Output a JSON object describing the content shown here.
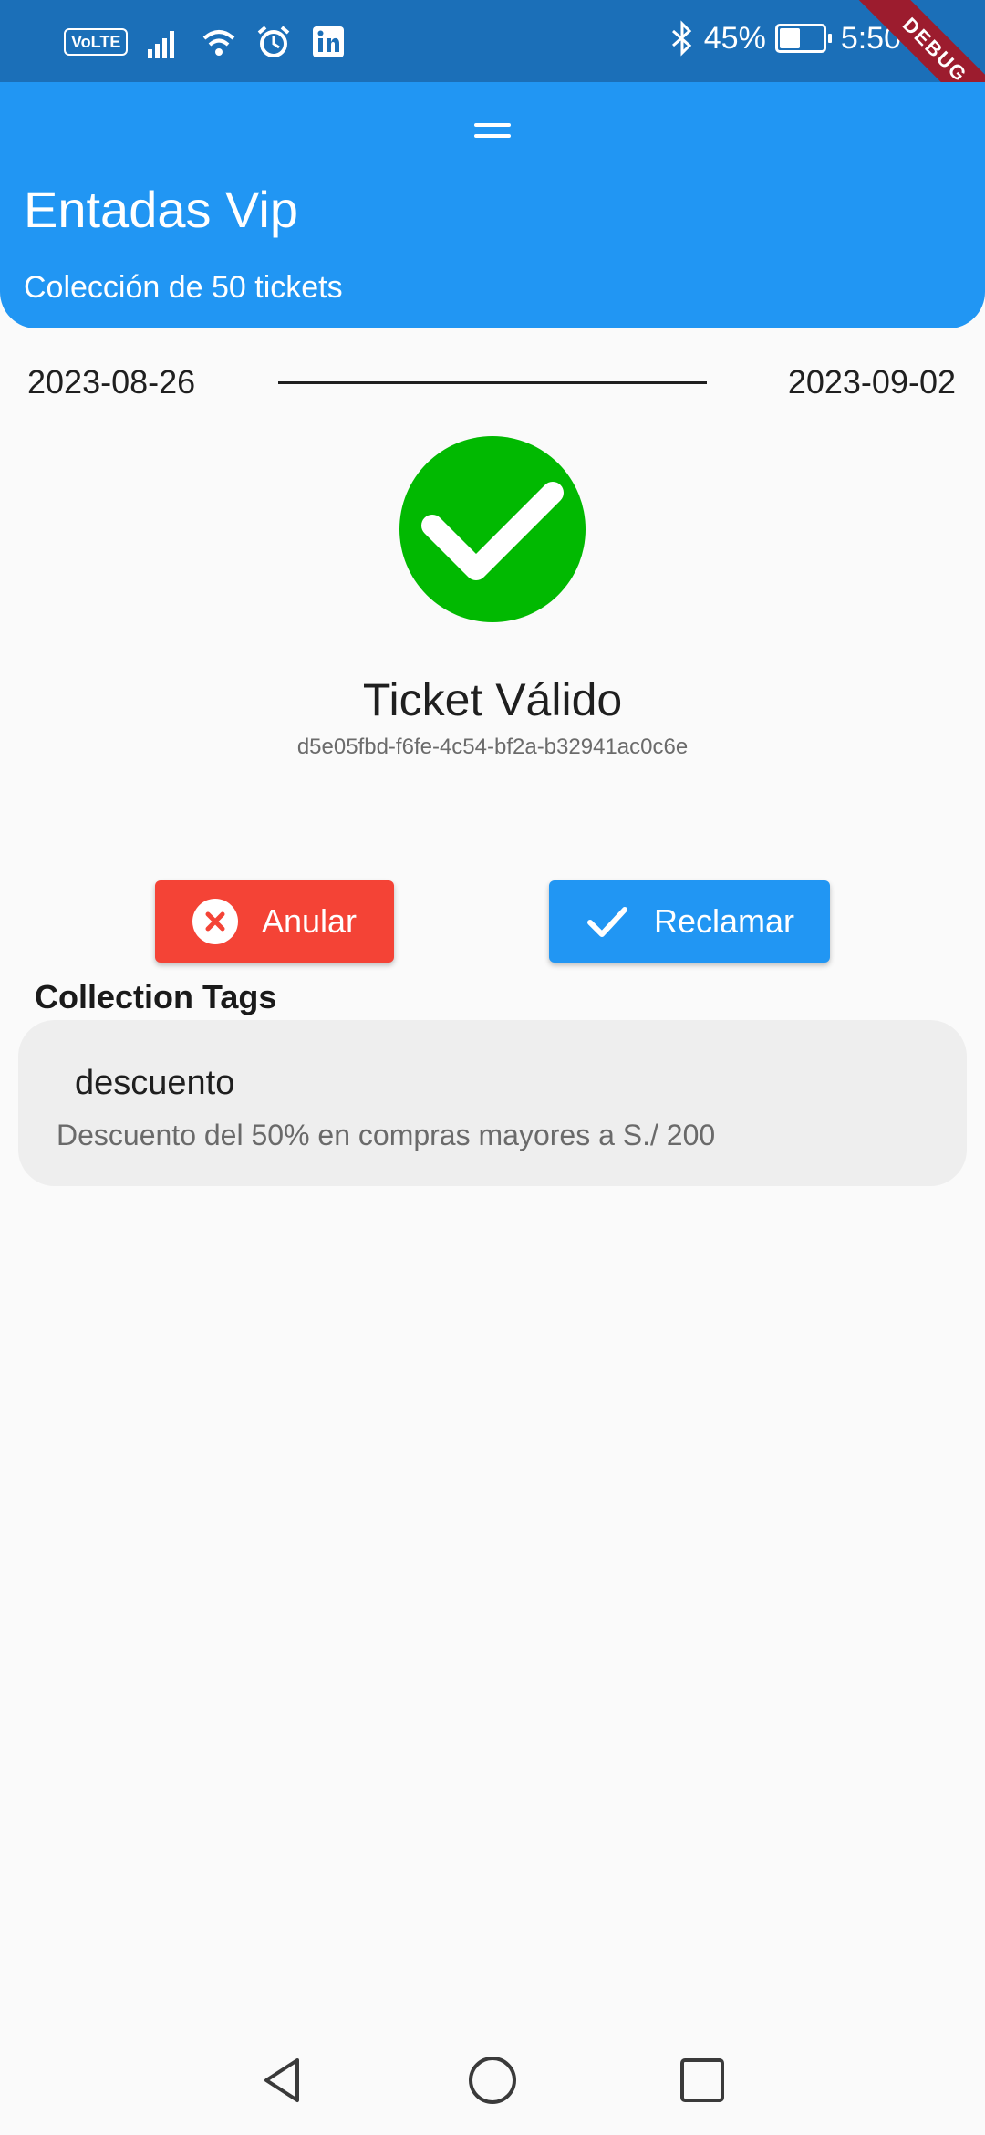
{
  "status_bar": {
    "volte": "VoLTE",
    "battery_text": "45%",
    "battery_level": 0.45,
    "time": "5:50",
    "debug": "DEBUG",
    "icons": [
      "signal-icon",
      "wifi-icon",
      "alarm-icon",
      "linkedin-icon",
      "bluetooth-icon",
      "battery-charging-icon"
    ]
  },
  "header": {
    "title": "Entadas Vip",
    "subtitle": "Colección de 50 tickets"
  },
  "dates": {
    "start": "2023-08-26",
    "end": "2023-09-02"
  },
  "ticket": {
    "status": "Ticket Válido",
    "id": "d5e05fbd-f6fe-4c54-bf2a-b32941ac0c6e",
    "status_color": "#01b901"
  },
  "actions": {
    "cancel_label": "Anular",
    "claim_label": "Reclamar",
    "cancel_color": "#f44336",
    "claim_color": "#2196f3"
  },
  "tags": {
    "section_title": "Collection Tags",
    "items": [
      {
        "name": "descuento",
        "description": "Descuento del 50% en compras mayores a S./ 200"
      }
    ]
  },
  "nav": {
    "icons": [
      "back-icon",
      "home-icon",
      "recents-icon"
    ]
  }
}
